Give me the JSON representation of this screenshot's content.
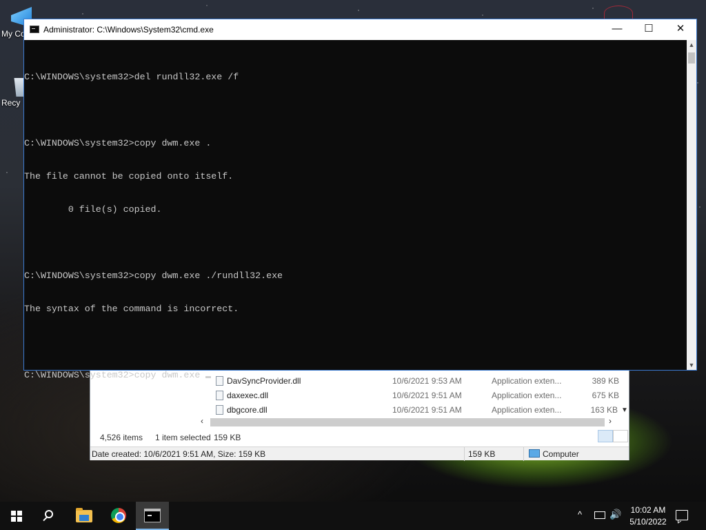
{
  "desktop": {
    "icons": [
      {
        "label": "My Co"
      },
      {
        "label": "Recy"
      }
    ]
  },
  "cmd": {
    "title": "Administrator: C:\\Windows\\System32\\cmd.exe",
    "lines": [
      "C:\\WINDOWS\\system32>del rundll32.exe /f",
      "",
      "C:\\WINDOWS\\system32>copy dwm.exe .",
      "The file cannot be copied onto itself.",
      "        0 file(s) copied.",
      "",
      "C:\\WINDOWS\\system32>copy dwm.exe ./rundll32.exe",
      "The syntax of the command is incorrect.",
      "",
      "C:\\WINDOWS\\system32>copy dwm.exe "
    ],
    "minimize": "—",
    "maximize": "☐",
    "close": "✕"
  },
  "explorer": {
    "files": [
      {
        "name": "DavSyncProvider.dll",
        "date": "10/6/2021 9:53 AM",
        "type": "Application exten...",
        "size": "389 KB"
      },
      {
        "name": "daxexec.dll",
        "date": "10/6/2021 9:51 AM",
        "type": "Application exten...",
        "size": "675 KB"
      },
      {
        "name": "dbgcore.dll",
        "date": "10/6/2021 9:51 AM",
        "type": "Application exten...",
        "size": "163 KB"
      }
    ],
    "status": {
      "items": "4,526 items",
      "selected": "1 item selected",
      "selected_size": "159 KB"
    },
    "details": {
      "info": "Date created: 10/6/2021 9:51 AM, Size: 159 KB",
      "size": "159 KB",
      "location": "Computer"
    }
  },
  "taskbar": {
    "time": "10:02 AM",
    "date": "5/10/2022",
    "tray_chevron": "^",
    "volume": "🔊"
  }
}
